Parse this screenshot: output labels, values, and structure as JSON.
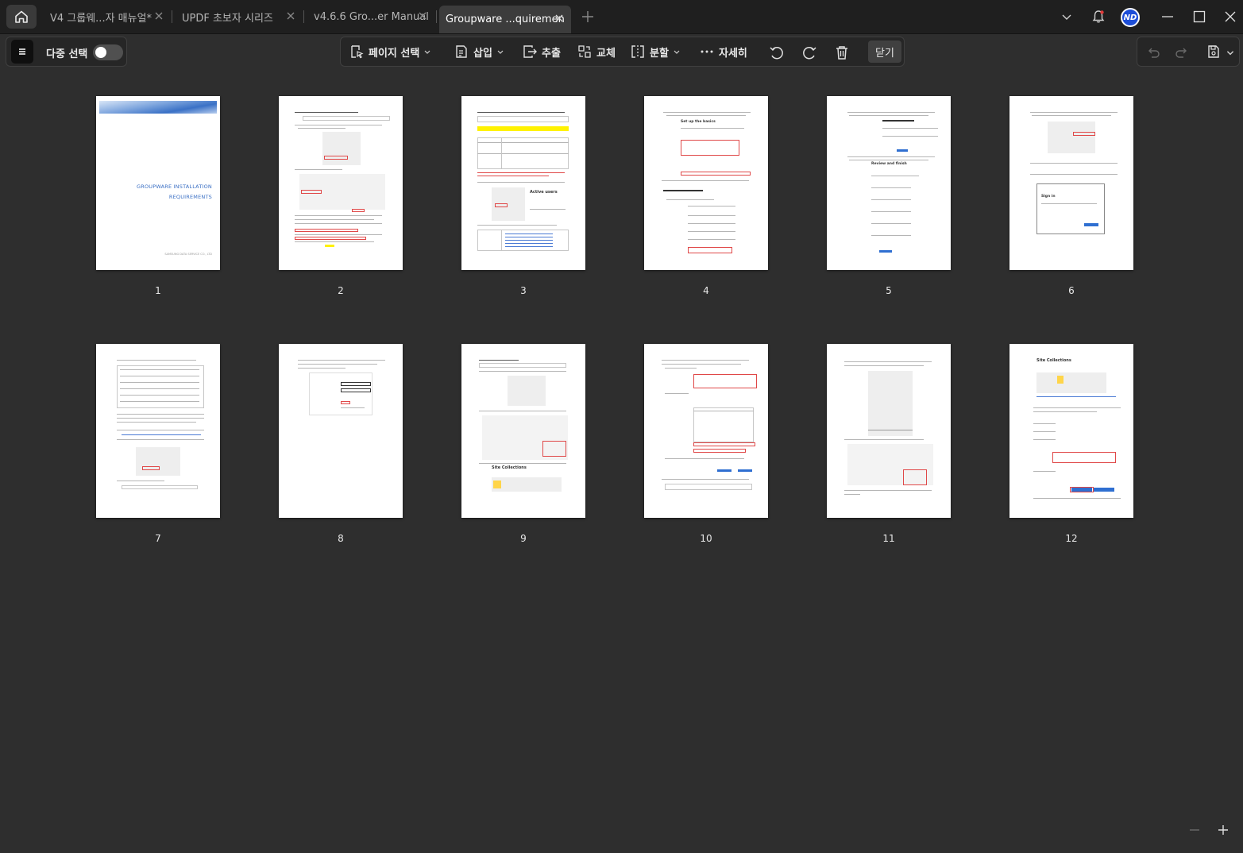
{
  "tabs": [
    {
      "label": "V4 그룹웨...자 매뉴얼*",
      "active": false
    },
    {
      "label": "UPDF 초보자 시리즈",
      "active": false
    },
    {
      "label": "v4.6.6 Gro...er Manual*",
      "active": false
    },
    {
      "label": "Groupware ...quirements",
      "active": true
    }
  ],
  "left_panel": {
    "multi_select_label": "다중 선택",
    "multi_select_on": false
  },
  "toolbar": {
    "page_select": "페이지 선택",
    "insert": "삽입",
    "extract": "추출",
    "replace": "교체",
    "split": "분할",
    "more": "자세히",
    "close": "닫기"
  },
  "user": {
    "initials": "ND"
  },
  "cover": {
    "title_line1": "GROUPWARE INSTALLATION",
    "title_line2": "REQUIREMENTS",
    "footer": "SAMSUNG DATA SERVICE CO., LTD"
  },
  "page_headings": {
    "p3": "Active users",
    "p4": "Set up the basics",
    "p5": "Review and finish",
    "p6": "Sign in",
    "p9": "Site Collections",
    "p12": "Site Collections"
  },
  "pages": [
    "1",
    "2",
    "3",
    "4",
    "5",
    "6",
    "7",
    "8",
    "9",
    "10",
    "11",
    "12"
  ],
  "colors": {
    "accent": "#2f6fd1",
    "highlight": "#fff200",
    "annotation": "#e04848",
    "avatar": "#1d4ed8"
  },
  "icons": [
    "home-icon",
    "close-icon",
    "plus-icon",
    "chevron-down-icon",
    "bell-icon",
    "minimize-icon",
    "maximize-icon",
    "window-close-icon",
    "menu-icon",
    "page-select-icon",
    "insert-icon",
    "extract-icon",
    "replace-icon",
    "split-icon",
    "more-icon",
    "rotate-left-icon",
    "rotate-right-icon",
    "delete-icon",
    "undo-icon",
    "redo-icon",
    "save-icon",
    "zoom-out-icon",
    "zoom-in-icon"
  ]
}
